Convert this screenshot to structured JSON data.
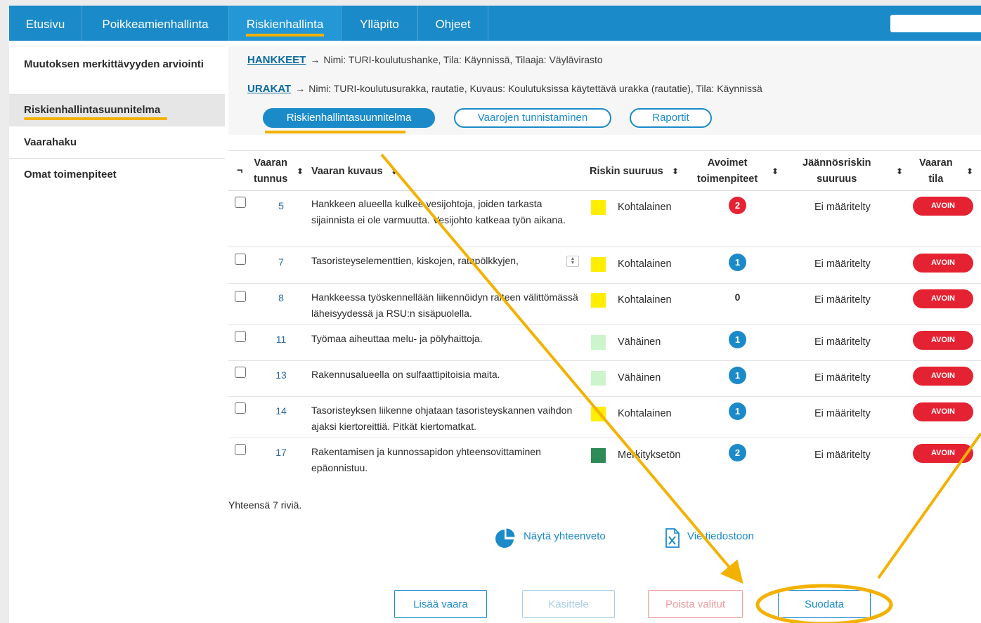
{
  "nav": {
    "items": [
      {
        "label": "Etusivu"
      },
      {
        "label": "Poikkeamienhallinta"
      },
      {
        "label": "Riskienhallinta"
      },
      {
        "label": "Ylläpito"
      },
      {
        "label": "Ohjeet"
      }
    ],
    "active": "Riskienhallinta"
  },
  "sidebar": {
    "items": [
      {
        "label": "Muutoksen merkittävyyden arviointi"
      },
      {
        "label": "Riskienhallintasuunnitelma"
      },
      {
        "label": "Vaarahaku"
      },
      {
        "label": "Omat toimenpiteet"
      }
    ],
    "active": "Riskienhallintasuunnitelma"
  },
  "breadcrumb": {
    "hankkeet": {
      "link": "HANKKEET",
      "arrow": "→",
      "text": "Nimi: TURI-koulutushanke, Tila: Käynnissä, Tilaaja: Väylävirasto"
    },
    "urakat": {
      "link": "URAKAT",
      "arrow": "→",
      "text": "Nimi: TURI-koulutusurakka, rautatie, Kuvaus: Koulutuksissa käytettävä urakka (rautatie), Tila: Käynnissä"
    }
  },
  "tabs": [
    {
      "label": "Riskienhallintasuunnitelma"
    },
    {
      "label": "Vaarojen tunnistaminen"
    },
    {
      "label": "Raportit"
    }
  ],
  "table": {
    "headers": {
      "select_all": "¬",
      "id": [
        "Vaaran",
        "tunnus"
      ],
      "desc": "Vaaran kuvaus",
      "severity": "Riskin suuruus",
      "open_actions": [
        "Avoimet",
        "toimenpiteet"
      ],
      "residual": [
        "Jäännösriskin",
        "suuruus"
      ],
      "status": [
        "Vaaran",
        "tila"
      ],
      "sort_glyph": "⬍"
    },
    "rows": [
      {
        "id": "5",
        "desc": "Hankkeen alueella kulkee vesijohtoja, joiden tarkasta sijainnista ei ole varmuutta. Vesijohto katkeaa työn aikana.",
        "color": "#ffee00",
        "severity": "Kohtalainen",
        "open": "2",
        "badge_color": "#e52231",
        "residual": "Ei määritelty",
        "status": "AVOIN"
      },
      {
        "id": "7",
        "desc": "Tasoristeyselementtien, kiskojen, ratapölkkyjen,",
        "color": "#ffee00",
        "severity": "Kohtalainen",
        "open": "1",
        "badge_color": "#1b8ac9",
        "residual": "Ei määritelty",
        "status": "AVOIN"
      },
      {
        "id": "8",
        "desc": "Hankkeessa työskennellään liikennöidyn raiteen välittömässä läheisyydessä ja RSU:n sisäpuolella.",
        "color": "#ffee00",
        "severity": "Kohtalainen",
        "open": "0",
        "badge_color": "",
        "residual": "Ei määritelty",
        "status": "AVOIN"
      },
      {
        "id": "11",
        "desc": "Työmaa aiheuttaa melu- ja pölyhaittoja.",
        "color": "#ccf5cc",
        "severity": "Vähäinen",
        "open": "1",
        "badge_color": "#1b8ac9",
        "residual": "Ei määritelty",
        "status": "AVOIN"
      },
      {
        "id": "13",
        "desc": "Rakennusalueella on sulfaattipitoisia maita.",
        "color": "#ccf5cc",
        "severity": "Vähäinen",
        "open": "1",
        "badge_color": "#1b8ac9",
        "residual": "Ei määritelty",
        "status": "AVOIN"
      },
      {
        "id": "14",
        "desc": "Tasoristeyksen liikenne ohjataan tasoristeyskannen vaihdon ajaksi kiertoreittiä. Pitkät kiertomatkat.",
        "color": "#ffee00",
        "severity": "Kohtalainen",
        "open": "1",
        "badge_color": "#1b8ac9",
        "residual": "Ei määritelty",
        "status": "AVOIN"
      },
      {
        "id": "17",
        "desc": "Rakentamisen ja kunnossapidon yhteensovittaminen epäonnistuu.",
        "color": "#2e8b57",
        "severity": "Merkityksetön",
        "open": "2",
        "badge_color": "#1b8ac9",
        "residual": "Ei määritelty",
        "status": "AVOIN"
      }
    ],
    "total": "Yhteensä 7 riviä."
  },
  "actions": {
    "summary": "Näytä yhteenveto",
    "export": "Vie tiedostoon"
  },
  "buttons": {
    "add": "Lisää vaara",
    "handle": "Käsittele",
    "delete": "Poista valitut",
    "filter": "Suodata"
  },
  "colors": {
    "brand": "#1b8ac9",
    "highlight": "#f3b100",
    "status_red": "#e52231"
  }
}
